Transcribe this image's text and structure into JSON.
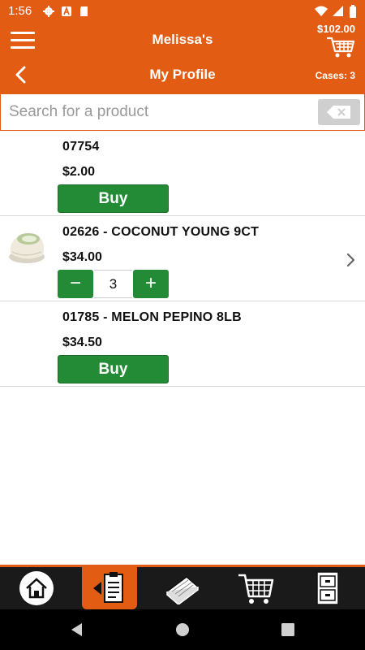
{
  "status_bar": {
    "time": "1:56",
    "left_icons": [
      "gear-icon",
      "a-icon",
      "sd-card-icon"
    ],
    "right_icons": [
      "wifi-icon",
      "signal-icon",
      "battery-icon"
    ]
  },
  "header": {
    "store_name": "Melissa's",
    "cart_total": "$102.00",
    "page_title": "My Profile",
    "cases": "Cases: 3"
  },
  "search": {
    "placeholder": "Search for a product",
    "value": ""
  },
  "products": [
    {
      "name": "07754",
      "price": "$2.00",
      "action": "Buy",
      "has_image": false
    },
    {
      "name": "02626 - COCONUT YOUNG 9CT",
      "price": "$34.00",
      "quantity": "3",
      "minus": "−",
      "plus": "+",
      "has_image": true
    },
    {
      "name": "01785 - MELON PEPINO 8LB",
      "price": "$34.50",
      "action": "Buy",
      "has_image": false
    }
  ],
  "bottom_nav": [
    {
      "icon": "home-icon",
      "active": false
    },
    {
      "icon": "order-clipboard-icon",
      "active": true
    },
    {
      "icon": "catalog-book-icon",
      "active": false
    },
    {
      "icon": "cart-icon",
      "active": false
    },
    {
      "icon": "cabinet-icon",
      "active": false
    }
  ],
  "colors": {
    "brand": "#e35c14",
    "buy_green": "#238a35",
    "nav_dark": "#1a1a1a"
  }
}
